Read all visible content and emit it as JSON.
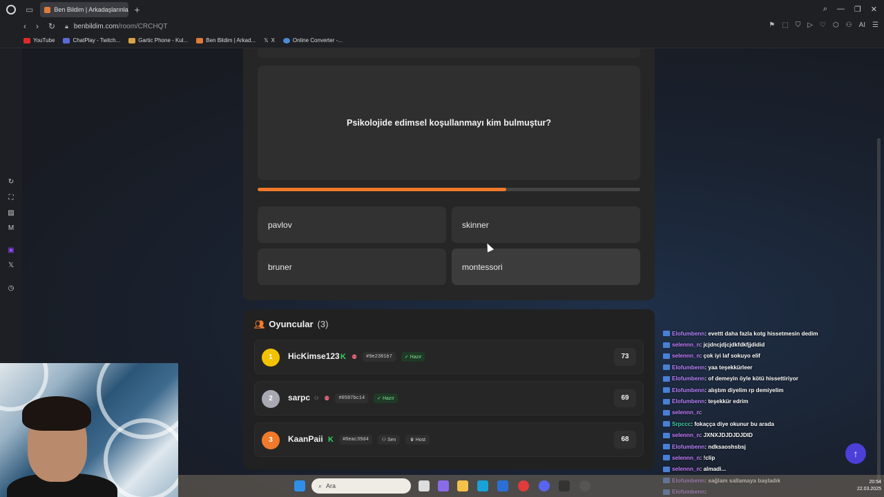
{
  "browser": {
    "tab_title": "Ben Bildim | Arkadaşlarınla",
    "url_host": "benbildim.com",
    "url_path": "/room/CRCHQT",
    "right_tool_ai": "AI"
  },
  "bookmarks": [
    {
      "label": "YouTube",
      "color": "#e02a2a"
    },
    {
      "label": "ChatPlay - Twitch...",
      "color": "#5b6bd6"
    },
    {
      "label": "Gartic Phone - Kul...",
      "color": "#d9a343"
    },
    {
      "label": "Ben Bildim | Arkad...",
      "color": "#e07b3a"
    },
    {
      "label": "X",
      "color": "#dddddd"
    },
    {
      "label": "Online Converter -...",
      "color": "#4a8ad6"
    }
  ],
  "quiz": {
    "question": "Psikolojide edimsel koşullanmayı kim bulmuştur?",
    "progress": 0.65,
    "answers": [
      "pavlov",
      "skinner",
      "bruner",
      "montessori"
    ]
  },
  "players": {
    "title": "Oyuncular",
    "count": "(3)",
    "list": [
      {
        "rank": "1",
        "name": "HicKimse123",
        "id": "#9e2381b7",
        "status": "Hazır",
        "score": "73",
        "rank_color": "#f2c200"
      },
      {
        "rank": "2",
        "name": "sarpc",
        "id": "#0587bc14",
        "status": "Hazır",
        "score": "69",
        "rank_color": "#a9a9b4"
      },
      {
        "rank": "3",
        "name": "KaanPaii",
        "id": "#0eac39d4",
        "self_label": "Sen",
        "host_label": "Host",
        "score": "68",
        "rank_color": "#f07a2a"
      }
    ]
  },
  "chat": [
    {
      "user": "Elofumbenn",
      "msg": ": evettt daha fazla kotg hissetmesin dedim",
      "color": "#b983ff"
    },
    {
      "user": "selennn_n",
      "msg": ": jcjdncjdjcjdkfdkfjjdidid",
      "color": "#c77dff"
    },
    {
      "user": "selennn_n",
      "msg": ": çok iyi laf sokuyo elif",
      "color": "#c77dff"
    },
    {
      "user": "Elofumbenn",
      "msg": ": yaa teşekkürleer",
      "color": "#b983ff"
    },
    {
      "user": "Elofumbenn",
      "msg": ": of demeyin öyle kötü hissettiriyor",
      "color": "#b983ff"
    },
    {
      "user": "Elofumbenn",
      "msg": ": alıştım diyelim rp demiyelim",
      "color": "#b983ff"
    },
    {
      "user": "Elofumbenn",
      "msg": ": teşekkür edrim",
      "color": "#b983ff"
    },
    {
      "user": "selennn_n",
      "msg": ":",
      "color": "#c77dff"
    },
    {
      "user": "Srpccc",
      "msg": ": fokaçça diye okunur bu arada",
      "color": "#3fd1a0"
    },
    {
      "user": "selennn_n",
      "msg": ": JXNXJDJDJDJDID",
      "color": "#c77dff"
    },
    {
      "user": "Elofumbenn",
      "msg": ": ndksaoshsbsj",
      "color": "#b983ff"
    },
    {
      "user": "selennn_n",
      "msg": ": !clip",
      "color": "#c77dff"
    },
    {
      "user": "selennn_n",
      "msg": ": almadi...",
      "color": "#c77dff"
    },
    {
      "user": "Elofumbenn",
      "msg": ": sağlam sallamaya başladık",
      "color": "#b983ff"
    },
    {
      "user": "Elofumbenn",
      "msg": ":",
      "color": "#b983ff"
    }
  ],
  "taskbar": {
    "search_placeholder": "Ara",
    "time": "20:54",
    "date": "22.03.2025"
  }
}
